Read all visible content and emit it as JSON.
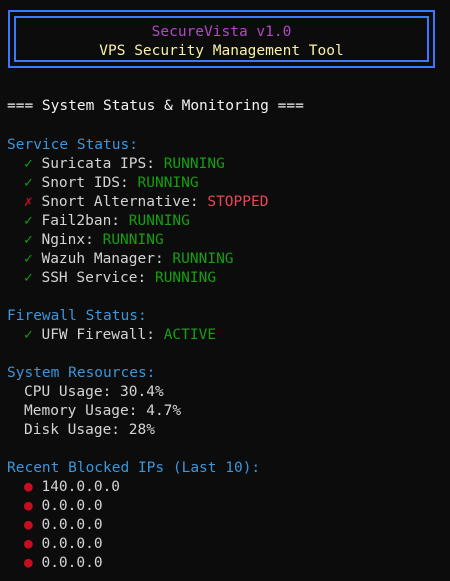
{
  "banner": {
    "title": "SecureVista v1.0",
    "subtitle": "VPS Security Management Tool"
  },
  "heading": "=== System Status & Monitoring ===",
  "services": {
    "title": "Service Status:",
    "items": [
      {
        "mark": "✓",
        "name": "Suricata IPS:",
        "status": "RUNNING",
        "ok": true
      },
      {
        "mark": "✓",
        "name": "Snort IDS:",
        "status": "RUNNING",
        "ok": true
      },
      {
        "mark": "✗",
        "name": "Snort Alternative:",
        "status": "STOPPED",
        "ok": false
      },
      {
        "mark": "✓",
        "name": "Fail2ban:",
        "status": "RUNNING",
        "ok": true
      },
      {
        "mark": "✓",
        "name": "Nginx:",
        "status": "RUNNING",
        "ok": true
      },
      {
        "mark": "✓",
        "name": "Wazuh Manager:",
        "status": "RUNNING",
        "ok": true
      },
      {
        "mark": "✓",
        "name": "SSH Service:",
        "status": "RUNNING",
        "ok": true
      }
    ]
  },
  "firewall": {
    "title": "Firewall Status:",
    "mark": "✓",
    "name": "UFW Firewall:",
    "status": "ACTIVE"
  },
  "resources": {
    "title": "System Resources:",
    "cpu": "CPU Usage: 30.4%",
    "memory": "Memory Usage: 4.7%",
    "disk": "Disk Usage: 28%"
  },
  "blocked": {
    "title": "Recent Blocked IPs (Last 10):",
    "bullet": "●",
    "ips": [
      "140.0.0.0",
      "0.0.0.0",
      "0.0.0.0",
      "0.0.0.0",
      "0.0.0.0"
    ]
  },
  "colors": {
    "border": "#3b78ff",
    "section": "#3a96dd",
    "ok": "#13a10e",
    "stopped": "#e74856",
    "title": "#b148c6",
    "subtitle": "#f9f1a5"
  }
}
